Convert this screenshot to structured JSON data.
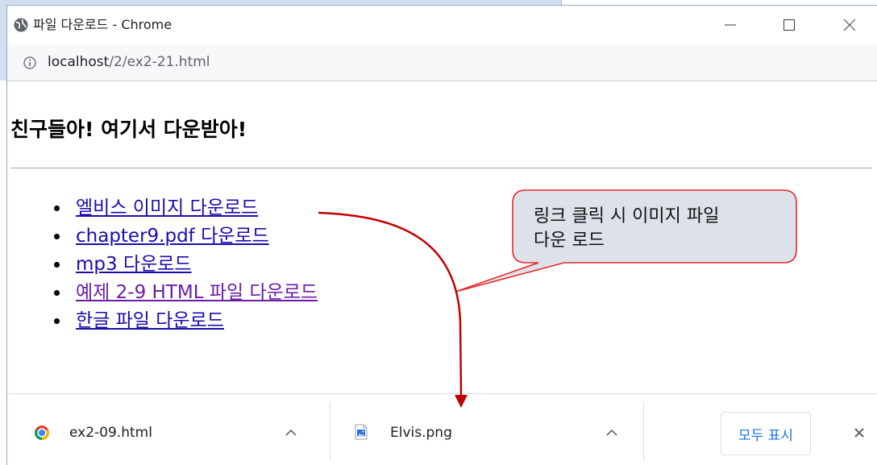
{
  "window": {
    "title": "파일 다운로드 - Chrome",
    "icon": "globe-icon",
    "controls": [
      "minimize-icon",
      "maximize-icon",
      "close-icon"
    ]
  },
  "address_bar": {
    "icon": "info-icon",
    "host": "localhost",
    "path": "/2/ex2-21.html"
  },
  "page": {
    "heading": "친구들아! 여기서 다운받아!",
    "links": [
      {
        "label": "엘비스 이미지 다운로드",
        "visited": false
      },
      {
        "label": "chapter9.pdf 다운로드",
        "visited": false
      },
      {
        "label": "mp3 다운로드",
        "visited": false
      },
      {
        "label": "예제 2-9 HTML 파일 다운로드",
        "visited": true
      },
      {
        "label": "한글 파일 다운로드",
        "visited": false
      }
    ]
  },
  "callout": {
    "lines": [
      "링크 클릭 시 이미지 파일",
      "다운 로드"
    ]
  },
  "download_shelf": {
    "items": [
      {
        "filename": "ex2-09.html",
        "icon": "chrome-icon"
      },
      {
        "filename": "Elvis.png",
        "icon": "image-file-icon"
      }
    ],
    "show_all_label": "모두 표시",
    "close_icon": "close-icon"
  },
  "colors": {
    "link": "#1a0dab",
    "visited_link": "#681da8",
    "callout_fill": "#dde2ea",
    "callout_border": "#e8262a",
    "arrow": "#c00000",
    "show_all_text": "#1a73e8"
  }
}
